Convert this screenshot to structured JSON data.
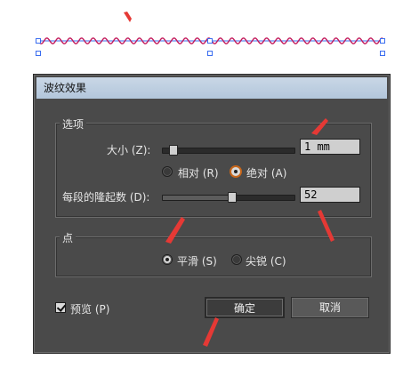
{
  "dialog": {
    "title": "波纹效果",
    "options_group": {
      "title": "选项",
      "size_label": "大小 (Z):",
      "size_value": "1 mm",
      "size_slider_fraction": 0.05,
      "relative_label": "相对 (R)",
      "absolute_label": "绝对 (A)",
      "selected_mode": "absolute",
      "ridges_label": "每段的隆起数 (D):",
      "ridges_value": "52",
      "ridges_slider_fraction": 0.52
    },
    "points_group": {
      "title": "点",
      "smooth_label": "平滑 (S)",
      "corner_label": "尖锐 (C)",
      "selected_point": "smooth"
    },
    "preview_label": "预览 (P)",
    "preview_checked": true,
    "ok_label": "确定",
    "cancel_label": "取消"
  },
  "colors": {
    "dialog_bg": "#4a4a4a",
    "titlebar": "#c9d7e6",
    "wave": "#c2185b",
    "selection": "#3a6df0",
    "annotation_arrow": "#e53935",
    "focus_ring": "#c7661a"
  }
}
